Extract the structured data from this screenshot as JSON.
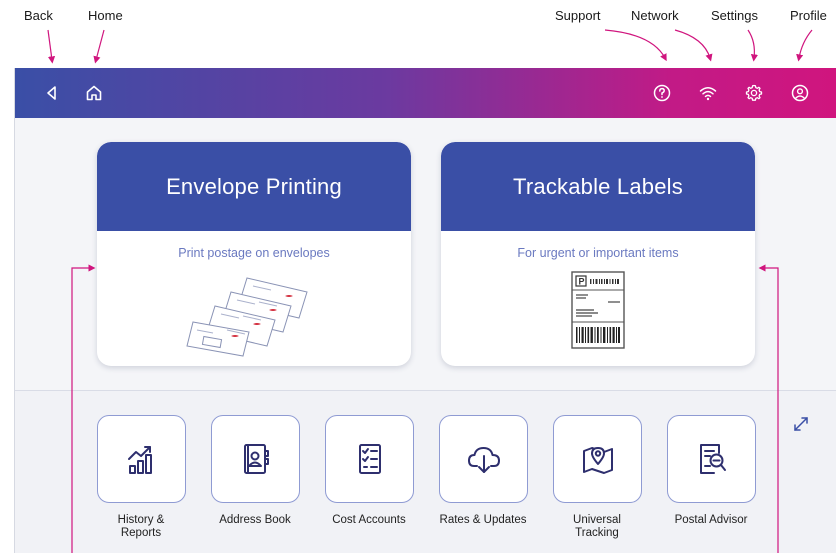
{
  "annotations": {
    "back": "Back",
    "home": "Home",
    "support": "Support",
    "network": "Network",
    "settings": "Settings",
    "profile": "Profile"
  },
  "cards": [
    {
      "title": "Envelope Printing",
      "subtitle": "Print postage on envelopes",
      "icon": "envelopes-illustration"
    },
    {
      "title": "Trackable Labels",
      "subtitle": "For urgent or important items",
      "icon": "shipping-label-illustration"
    }
  ],
  "tiles": [
    {
      "label": "History & Reports",
      "icon": "chart-trend-icon"
    },
    {
      "label": "Address Book",
      "icon": "address-book-icon"
    },
    {
      "label": "Cost Accounts",
      "icon": "checklist-icon"
    },
    {
      "label": "Rates & Updates",
      "icon": "cloud-download-icon"
    },
    {
      "label": "Universal Tracking",
      "icon": "map-pin-icon"
    },
    {
      "label": "Postal Advisor",
      "icon": "document-search-icon"
    }
  ],
  "colors": {
    "header_gradient_start": "#3a4fa6",
    "header_gradient_end": "#d0157e",
    "card_header": "#3a4fa6",
    "accent_text": "#6a79c0",
    "annotation_arrow": "#d0157e"
  }
}
